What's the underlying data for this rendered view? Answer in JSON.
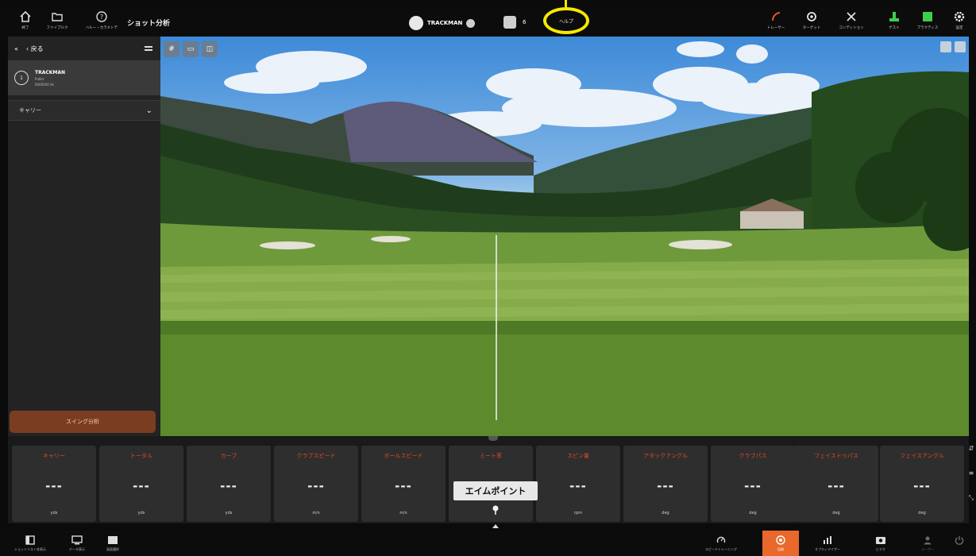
{
  "topbar": {
    "left_buttons": [
      {
        "icon": "home-icon",
        "label": "終了"
      },
      {
        "icon": "folder-icon",
        "label": "ファイブルク"
      },
      {
        "icon": "question-icon",
        "label": "ハルー・カラメトテ"
      }
    ],
    "title": "ショット分析",
    "user": {
      "name": "TRACKMAN"
    },
    "club": {
      "number": "6"
    },
    "help_label": "ヘルプ",
    "right_buttons": [
      {
        "icon": "tracker-icon",
        "label": "トレーサー",
        "color": "#e2562a"
      },
      {
        "icon": "target-icon",
        "label": "ターゲット",
        "color": "#e8e8e8"
      },
      {
        "icon": "course-icon",
        "label": "コンディション",
        "color": "#e8e8e8"
      },
      {
        "icon": "tee-icon",
        "label": "ゲスト",
        "color": "#3ecf4a"
      },
      {
        "icon": "practice-icon",
        "label": "プラクティス",
        "color": "#3ecf4a"
      },
      {
        "icon": "settings-icon",
        "label": "設定",
        "color": "#e8e8e8"
      }
    ]
  },
  "left_panel": {
    "back_label": "戻る",
    "user_name": "TRACKMAN",
    "user_sub_1": "Public",
    "user_sub_2": "0000000 Hc",
    "selected_metric": "キャリー",
    "swing_button": "スイング分析"
  },
  "data_cards": [
    {
      "title": "キャリー",
      "value": "---",
      "unit": "yds"
    },
    {
      "title": "トータル",
      "value": "---",
      "unit": "yds"
    },
    {
      "title": "カーブ",
      "value": "---",
      "unit": "yds"
    },
    {
      "title": "クラブスピード",
      "value": "---",
      "unit": "m/s"
    },
    {
      "title": "ボールスピード",
      "value": "---",
      "unit": "m/s"
    },
    {
      "title": "ミート率",
      "value": "---",
      "unit": ""
    },
    {
      "title": "スピン量",
      "value": "---",
      "unit": "rpm"
    },
    {
      "title": "アタックアングル",
      "value": "---",
      "unit": "deg"
    },
    {
      "title": "クラブパス",
      "value": "---",
      "unit": "deg"
    },
    {
      "title": "フェイストゥパス",
      "value": "---",
      "unit": "deg"
    },
    {
      "title": "フェイスアングル",
      "value": "---",
      "unit": "deg"
    }
  ],
  "aim_point_tooltip": "エイムポイント",
  "bottombar": {
    "left_buttons": [
      {
        "icon": "panel-icon",
        "label": "ショットリスト非表示"
      },
      {
        "icon": "monitor-icon",
        "label": "データ表示"
      },
      {
        "icon": "layout-icon",
        "label": "画面選択"
      }
    ],
    "right_buttons": [
      {
        "icon": "gauge-icon",
        "label": "スピードトレーニング"
      },
      {
        "icon": "record-icon",
        "label": "記録",
        "active": true
      },
      {
        "icon": "chart-icon",
        "label": "オプティマイザー"
      },
      {
        "icon": "camera-icon",
        "label": "ビデオ"
      },
      {
        "icon": "user-icon",
        "label": "ユーザー"
      },
      {
        "icon": "power-icon",
        "label": ""
      }
    ]
  }
}
